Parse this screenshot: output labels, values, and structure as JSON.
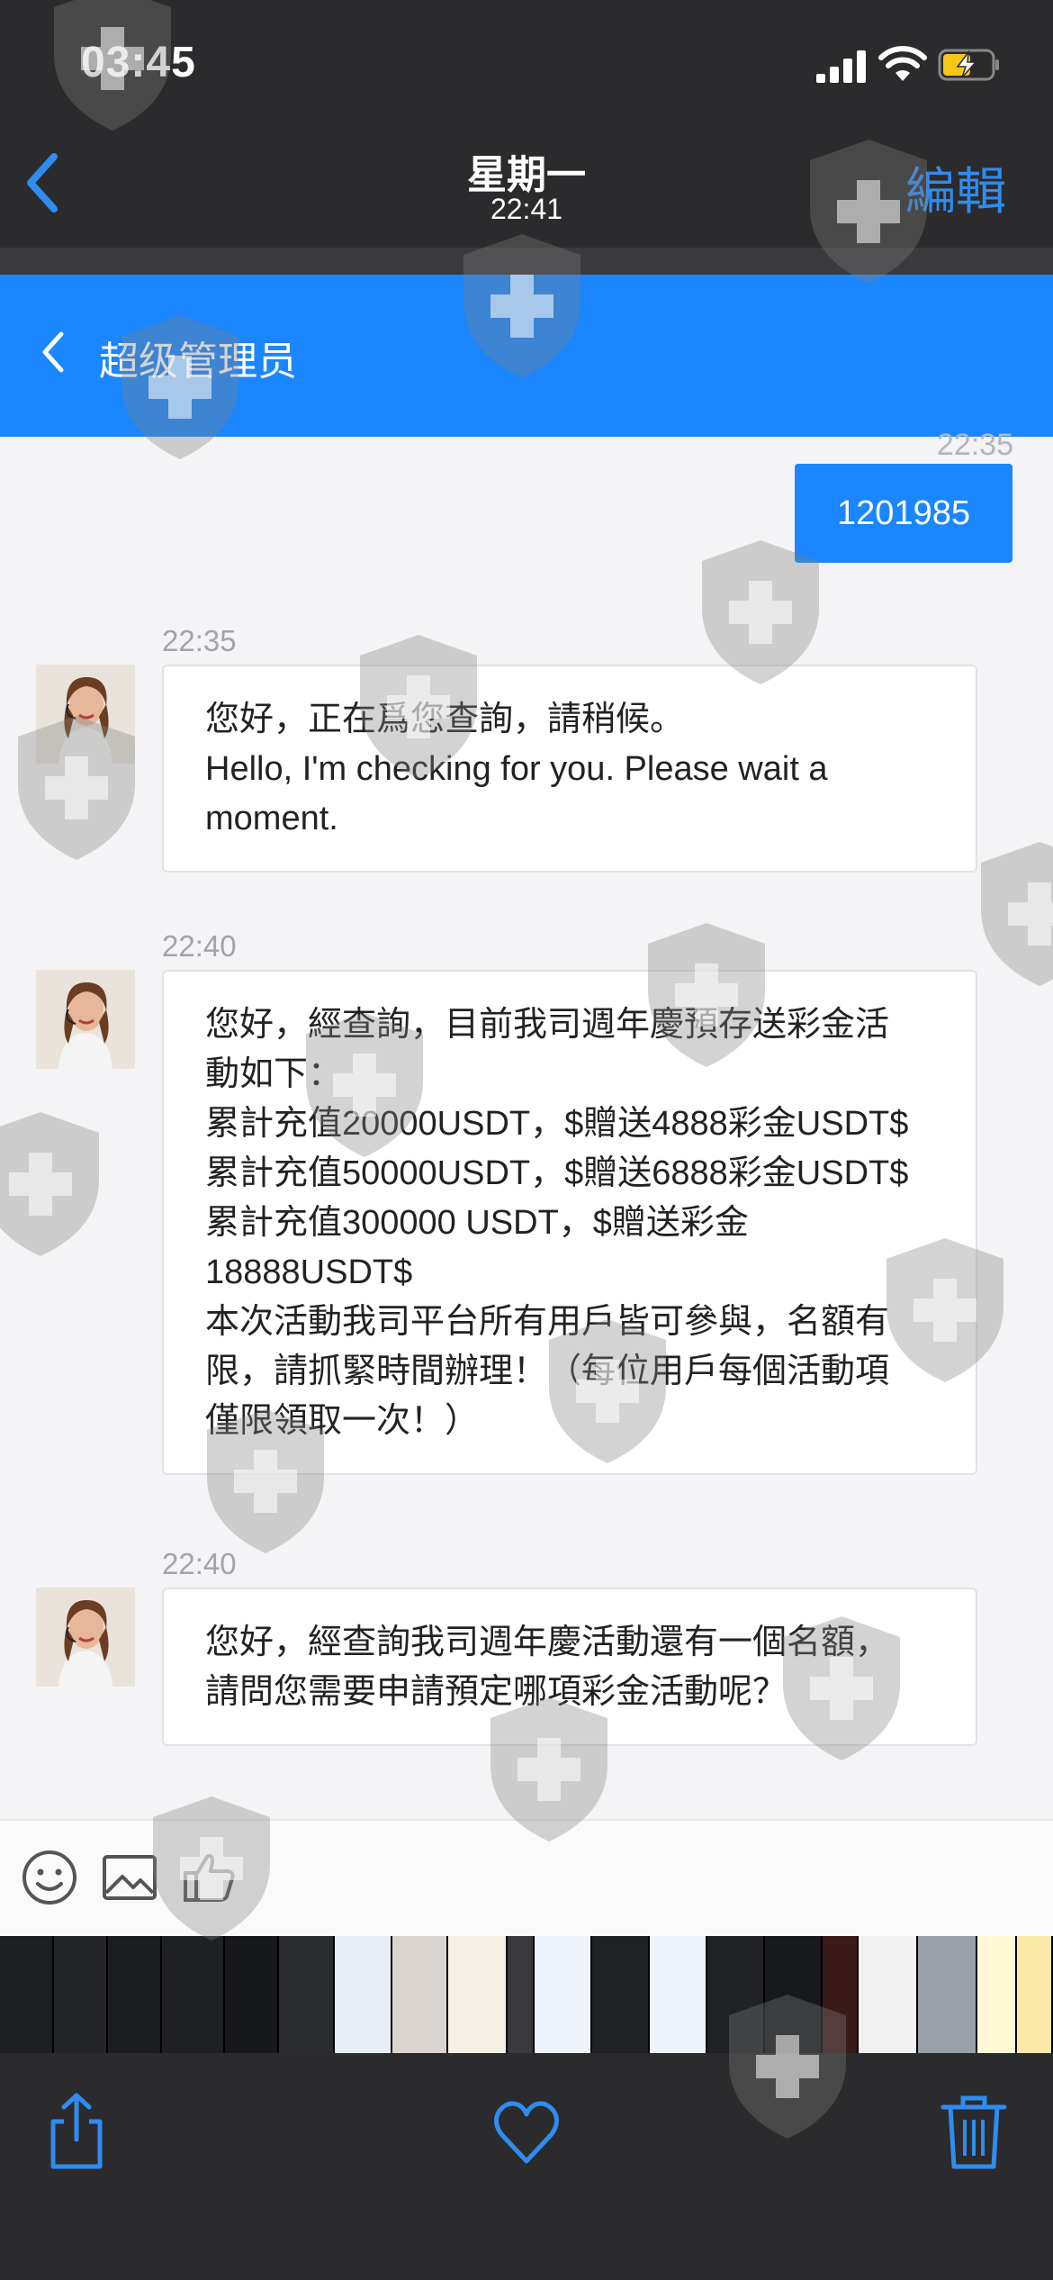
{
  "status_bar": {
    "time": "03:45"
  },
  "photos_header": {
    "day": "星期一",
    "time": "22:41",
    "edit_label": "編輯"
  },
  "chat": {
    "title": "超级管理员",
    "cut_time": "22:35",
    "sent_message": "1201985",
    "messages": [
      {
        "time": "22:35",
        "lines": [
          "您好，正在爲您查詢，請稍候。",
          "Hello, I'm checking for you. Please wait a",
          "moment."
        ]
      },
      {
        "time": "22:40",
        "lines": [
          "您好，經查詢，目前我司週年慶預存送彩金活",
          "動如下：",
          "累計充值20000USDT，$贈送4888彩金USDT$",
          "累計充值50000USDT，$贈送6888彩金USDT$",
          "累計充值300000 USDT，$贈送彩金",
          "18888USDT$",
          "本次活動我司平台所有用戶皆可參與，名額有",
          "限，請抓緊時間辦理！（每位用戶每個活動項",
          "僅限領取一次！）"
        ]
      },
      {
        "time": "22:40",
        "lines": [
          "您好，經查詢我司週年慶活動還有一個名額，",
          "請問您需要申請預定哪項彩金活動呢？"
        ]
      }
    ]
  },
  "icons": {
    "back": "chevron-left-icon",
    "emoji": "emoji-icon",
    "image": "image-icon",
    "like": "thumbs-up-icon",
    "share": "share-icon",
    "favorite": "heart-icon",
    "delete": "trash-icon"
  },
  "colors": {
    "accent": "#1a86ff",
    "ios_blue": "#2f8cf0",
    "dark_bg": "#2b2b2d",
    "battery": "#f5c518"
  }
}
